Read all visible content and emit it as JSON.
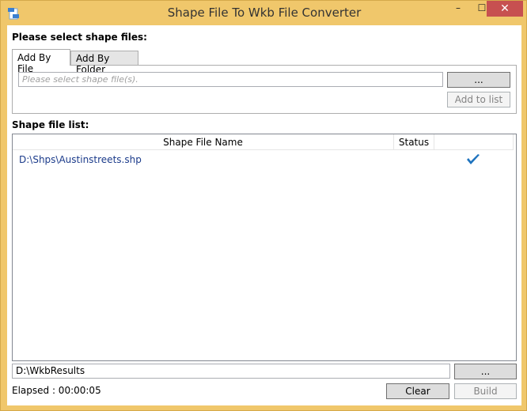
{
  "window": {
    "title": "Shape File To Wkb File Converter",
    "icon": "shapefile-app-icon",
    "controls": {
      "minimize": "–",
      "maximize": "☐",
      "close": "✕"
    }
  },
  "select_section": {
    "label": "Please select shape files:",
    "tabs": [
      {
        "label": "Add By File",
        "active": true
      },
      {
        "label": "Add By Folder",
        "active": false
      }
    ],
    "file_input": {
      "value": "",
      "placeholder": "Please select shape file(s)."
    },
    "browse_label": "...",
    "add_to_list_label": "Add to list"
  },
  "list_section": {
    "label": "Shape file list:",
    "columns": [
      "Shape File Name",
      "Status",
      ""
    ],
    "rows": [
      {
        "name": "D:\\Shps\\Austinstreets.shp",
        "status": "",
        "icon": "checkmark-icon"
      }
    ]
  },
  "output": {
    "path": "D:\\WkbResults",
    "browse_label": "...",
    "elapsed": "Elapsed : 00:00:05",
    "clear_label": "Clear",
    "build_label": "Build"
  },
  "colors": {
    "frame": "#f0c76b",
    "close": "#c75050",
    "check": "#1e73be",
    "link_text": "#1a3a8a"
  }
}
